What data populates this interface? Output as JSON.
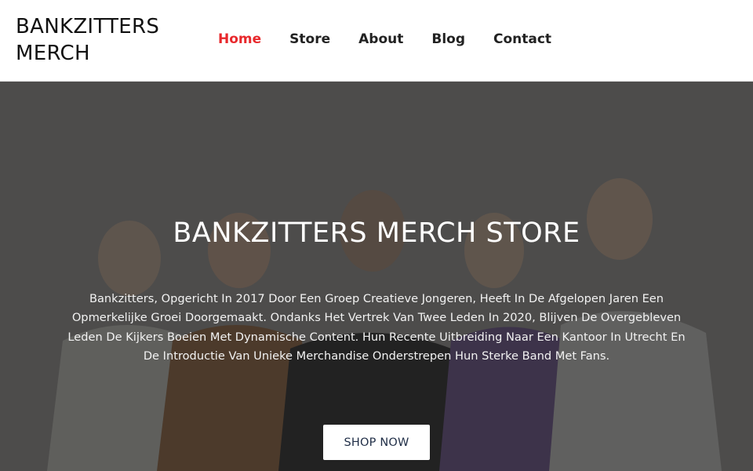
{
  "header": {
    "brand": "BANKZITTERS MERCH",
    "nav": [
      {
        "label": "Home",
        "active": true
      },
      {
        "label": "Store",
        "active": false
      },
      {
        "label": "About",
        "active": false
      },
      {
        "label": "Blog",
        "active": false
      },
      {
        "label": "Contact",
        "active": false
      }
    ]
  },
  "hero": {
    "title": "BANKZITTERS MERCH STORE",
    "description": "Bankzitters, Opgericht In 2017 Door Een Groep Creatieve Jongeren, Heeft In De Afgelopen Jaren Een Opmerkelijke Groei Doorgemaakt. Ondanks Het Vertrek Van Twee Leden In 2020, Blijven De Overgebleven Leden De Kijkers Boeien Met Dynamische Content. Hun Recente Uitbreiding Naar Een Kantoor In Utrecht En De Introductie Van Unieke Merchandise Onderstrepen Hun Sterke Band Met Fans.",
    "cta_label": "SHOP NOW"
  },
  "colors": {
    "accent": "#e8282c",
    "nav_text": "#222222",
    "hero_bg": "#4d4b4a",
    "button_text": "#1f2d46"
  }
}
